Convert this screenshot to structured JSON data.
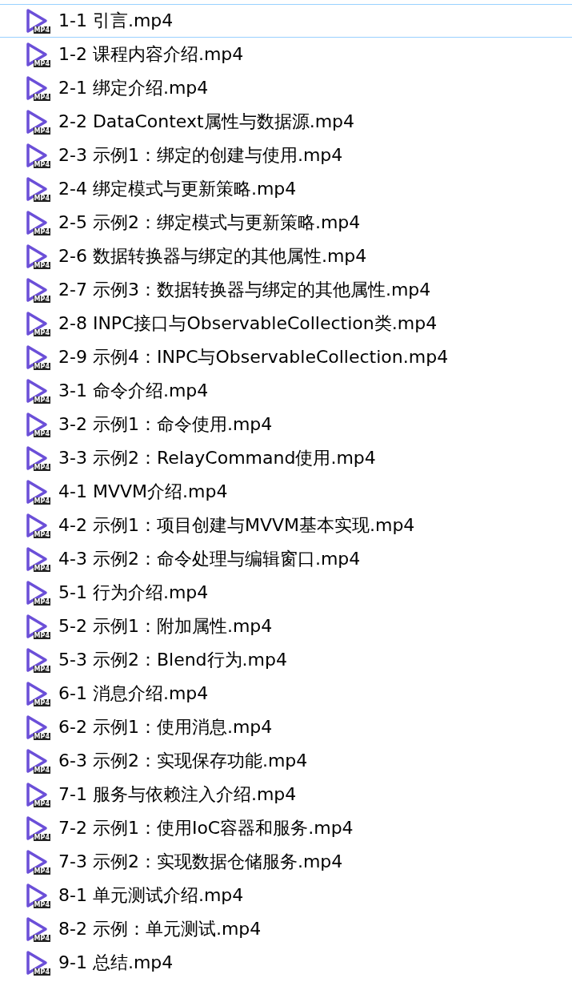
{
  "files": [
    {
      "name": "1-1 引言.mp4",
      "badge": "MP4",
      "selected": true
    },
    {
      "name": "1-2 课程内容介绍.mp4",
      "badge": "MP4",
      "selected": false
    },
    {
      "name": "2-1 绑定介绍.mp4",
      "badge": "MP4",
      "selected": false
    },
    {
      "name": "2-2 DataContext属性与数据源.mp4",
      "badge": "MP4",
      "selected": false
    },
    {
      "name": "2-3 示例1：绑定的创建与使用.mp4",
      "badge": "MP4",
      "selected": false
    },
    {
      "name": "2-4 绑定模式与更新策略.mp4",
      "badge": "MP4",
      "selected": false
    },
    {
      "name": "2-5 示例2：绑定模式与更新策略.mp4",
      "badge": "MP4",
      "selected": false
    },
    {
      "name": "2-6 数据转换器与绑定的其他属性.mp4",
      "badge": "MP4",
      "selected": false
    },
    {
      "name": "2-7 示例3：数据转换器与绑定的其他属性.mp4",
      "badge": "MP4",
      "selected": false
    },
    {
      "name": "2-8 INPC接口与ObservableCollection类.mp4",
      "badge": "MP4",
      "selected": false
    },
    {
      "name": "2-9 示例4：INPC与ObservableCollection.mp4",
      "badge": "MP4",
      "selected": false
    },
    {
      "name": "3-1 命令介绍.mp4",
      "badge": "MP4",
      "selected": false
    },
    {
      "name": "3-2 示例1：命令使用.mp4",
      "badge": "MP4",
      "selected": false
    },
    {
      "name": "3-3 示例2：RelayCommand使用.mp4",
      "badge": "MP4",
      "selected": false
    },
    {
      "name": "4-1 MVVM介绍.mp4",
      "badge": "MP4",
      "selected": false
    },
    {
      "name": "4-2 示例1：项目创建与MVVM基本实现.mp4",
      "badge": "MP4",
      "selected": false
    },
    {
      "name": "4-3 示例2：命令处理与编辑窗口.mp4",
      "badge": "MP4",
      "selected": false
    },
    {
      "name": "5-1 行为介绍.mp4",
      "badge": "MP4",
      "selected": false
    },
    {
      "name": "5-2 示例1：附加属性.mp4",
      "badge": "MP4",
      "selected": false
    },
    {
      "name": "5-3 示例2：Blend行为.mp4",
      "badge": "MP4",
      "selected": false
    },
    {
      "name": "6-1 消息介绍.mp4",
      "badge": "MP4",
      "selected": false
    },
    {
      "name": "6-2 示例1：使用消息.mp4",
      "badge": "MP4",
      "selected": false
    },
    {
      "name": "6-3 示例2：实现保存功能.mp4",
      "badge": "MP4",
      "selected": false
    },
    {
      "name": "7-1 服务与依赖注入介绍.mp4",
      "badge": "MP4",
      "selected": false
    },
    {
      "name": "7-2 示例1：使用IoC容器和服务.mp4",
      "badge": "MP4",
      "selected": false
    },
    {
      "name": "7-3 示例2：实现数据仓储服务.mp4",
      "badge": "MP4",
      "selected": false
    },
    {
      "name": "8-1 单元测试介绍.mp4",
      "badge": "MP4",
      "selected": false
    },
    {
      "name": "8-2 示例：单元测试.mp4",
      "badge": "MP4",
      "selected": false
    },
    {
      "name": "9-1 总结.mp4",
      "badge": "MP4",
      "selected": false
    }
  ]
}
